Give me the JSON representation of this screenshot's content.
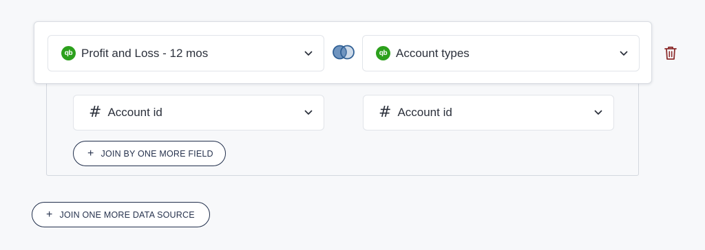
{
  "join": {
    "left_source": {
      "icon": "quickbooks-icon",
      "icon_text": "qb",
      "label": "Profit and Loss - 12 mos"
    },
    "right_source": {
      "icon": "quickbooks-icon",
      "icon_text": "qb",
      "label": "Account types"
    },
    "join_type_icon": "venn-join-icon",
    "delete_icon": "trash-icon",
    "fields": [
      {
        "left": {
          "icon": "hash-icon",
          "icon_text": "#",
          "label": "Account id"
        },
        "right": {
          "icon": "hash-icon",
          "icon_text": "#",
          "label": "Account id"
        }
      }
    ],
    "add_field_button": "JOIN BY ONE MORE FIELD"
  },
  "add_source_button": "JOIN ONE MORE DATA SOURCE",
  "colors": {
    "quickbooks_green": "#2ca01c",
    "venn_fill": "#6f94bf",
    "venn_stroke": "#2f5f94",
    "trash": "#8b2a2a",
    "button_border": "#1f2d4a"
  }
}
